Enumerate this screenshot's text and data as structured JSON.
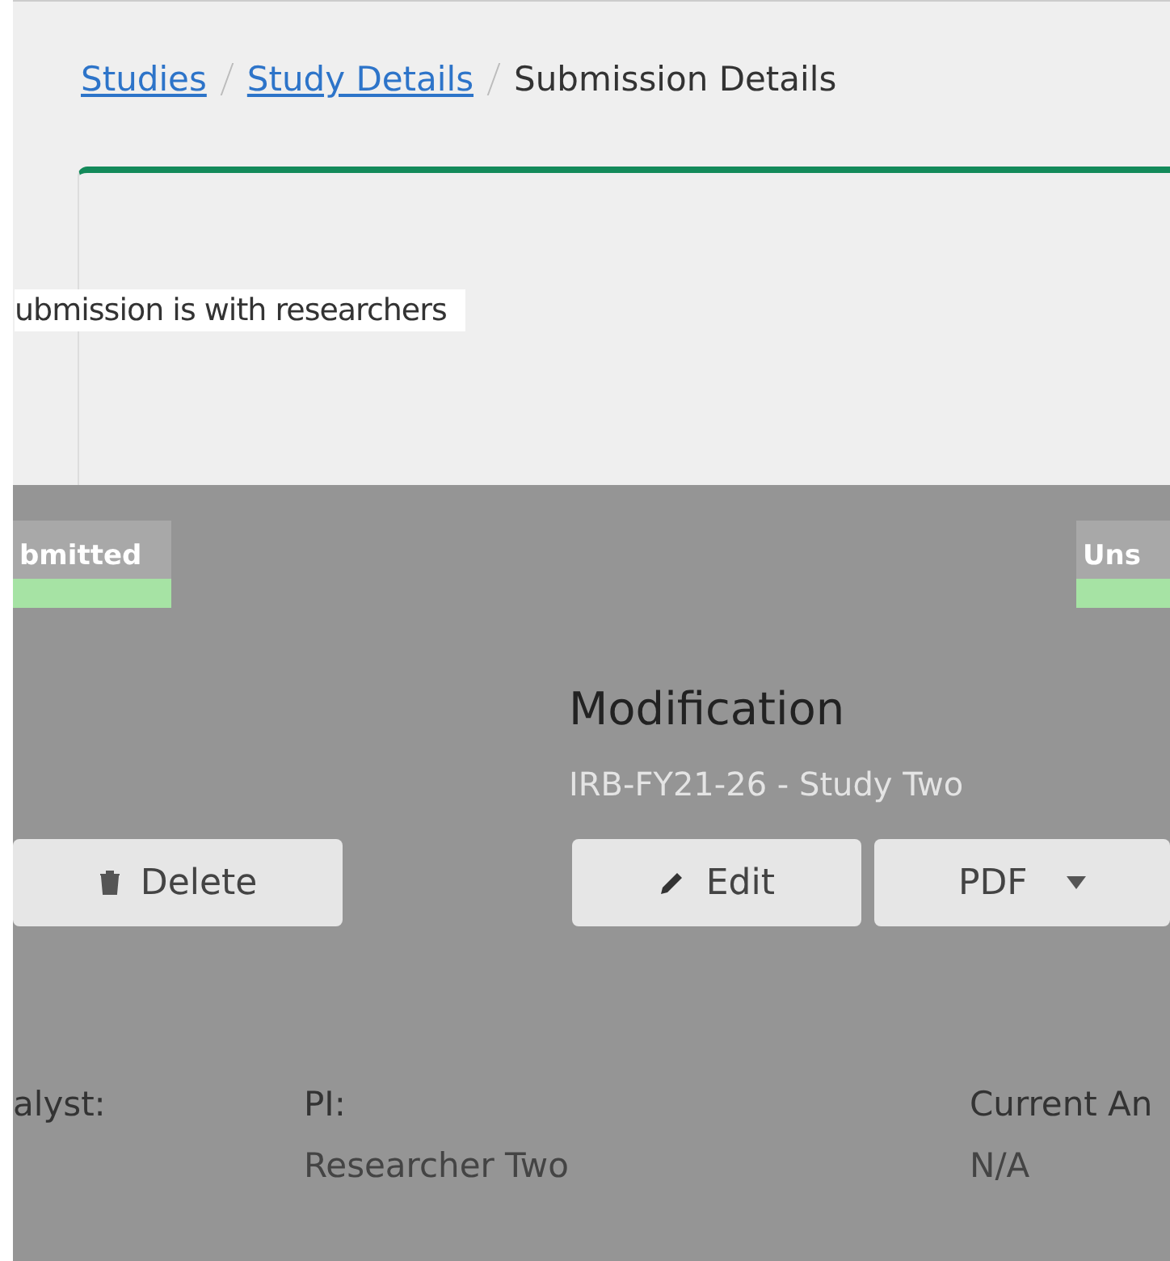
{
  "breadcrumbs": [
    {
      "label": "Studies",
      "kind": "link"
    },
    {
      "label": "Study Details",
      "kind": "link"
    },
    {
      "label": "Submission Details",
      "kind": "current"
    }
  ],
  "status": {
    "text": "ubmission is with researchers"
  },
  "badges": [
    {
      "label": "bmitted"
    },
    {
      "label": "Uns"
    }
  ],
  "submission": {
    "title": "Modification",
    "subtitle": "IRB-FY21-26 - Study Two"
  },
  "buttons": [
    {
      "label": "Delete",
      "kind": "delete"
    },
    {
      "label": "Edit",
      "kind": "edit"
    },
    {
      "label": "PDF",
      "kind": "dropdown"
    }
  ],
  "fields": [
    {
      "label": "alyst:"
    },
    {
      "label": "PI:",
      "value": "Researcher Two"
    },
    {
      "label": "Current An",
      "value": "N/A"
    }
  ]
}
